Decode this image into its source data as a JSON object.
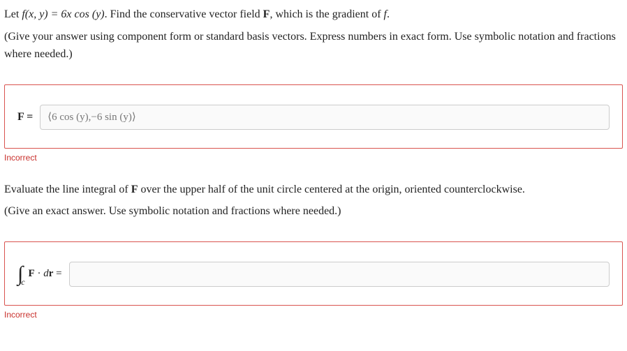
{
  "question1": {
    "line1_pre": "Let ",
    "line1_func": "f(x, y) = 6x cos (y)",
    "line1_post": ". Find the conservative vector field ",
    "line1_F": "F",
    "line1_end": ", which is the gradient of ",
    "line1_fvar": "f",
    "line1_period": ".",
    "line2": "(Give your answer using component form or standard basis vectors. Express numbers in exact form. Use symbolic notation and fractions where needed.)"
  },
  "answer1": {
    "label": "F =",
    "value": "⟨6 cos (y),−6 sin (y)⟩",
    "status": "Incorrect"
  },
  "question2": {
    "line1_pre": "Evaluate the line integral of ",
    "line1_F": "F",
    "line1_post": " over the upper half of the unit circle centered at the origin, oriented counterclockwise.",
    "line2": "(Give an exact answer. Use symbolic notation and fractions where needed.)"
  },
  "answer2": {
    "integral_sym": "∫",
    "integral_sub": "c",
    "fdr_F": "F",
    "fdr_dot": " · ",
    "fdr_d": "d",
    "fdr_r": "r",
    "fdr_eq": " =",
    "value": "",
    "status": "Incorrect"
  }
}
